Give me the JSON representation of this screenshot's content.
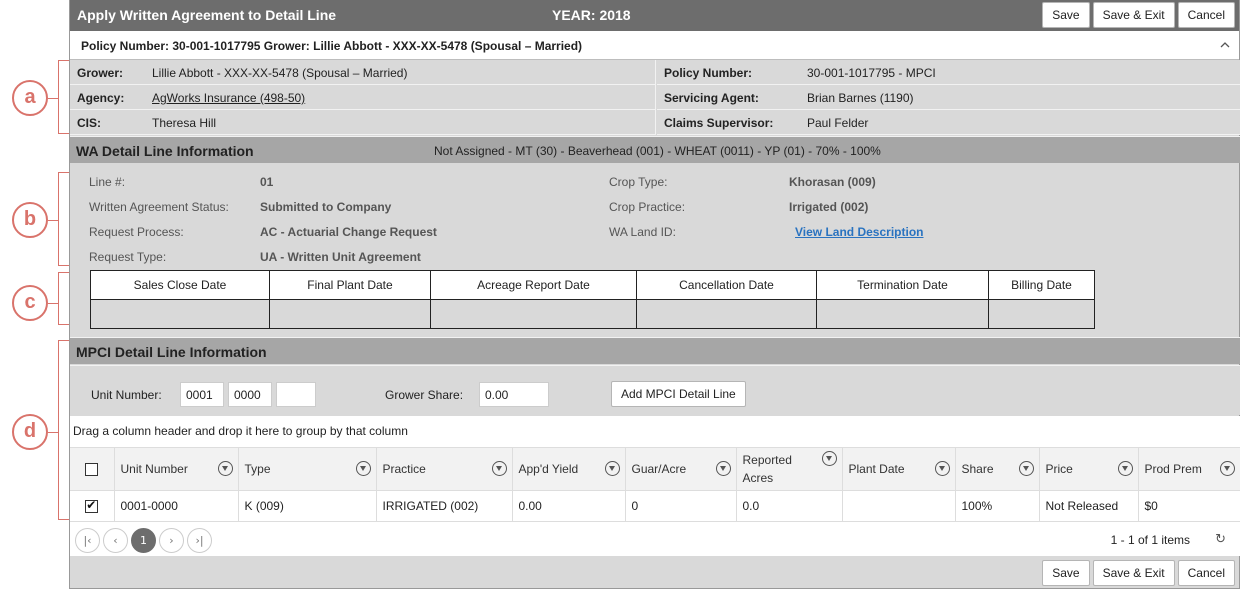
{
  "callouts": [
    "a",
    "b",
    "c",
    "d"
  ],
  "window": {
    "title": "Apply Written Agreement to Detail Line",
    "year": "YEAR: 2018"
  },
  "actions": {
    "save": "Save",
    "save_exit": "Save & Exit",
    "cancel": "Cancel"
  },
  "policy_bar": {
    "text": "Policy Number: 30-001-1017795 Grower: Lillie Abbott - XXX-XX-5478 (Spousal – Married)"
  },
  "info": {
    "grower_label": "Grower:",
    "grower": "Lillie Abbott - XXX-XX-5478 (Spousal – Married)",
    "agency_label": "Agency:",
    "agency": "AgWorks Insurance (498-50)",
    "cis_label": "CIS:",
    "cis": "Theresa Hill",
    "policy_label": "Policy Number:",
    "policy": "30-001-1017795 - MPCI",
    "agent_label": "Servicing Agent:",
    "agent": "Brian Barnes (1190)",
    "supervisor_label": "Claims Supervisor:",
    "supervisor": "Paul Felder"
  },
  "wa_section": {
    "title": "WA Detail Line Information",
    "summary": "Not Assigned - MT (30) - Beaverhead (001) - WHEAT (0011) - YP (01) - 70% - 100%"
  },
  "wa": {
    "line_label": "Line #:",
    "line": "01",
    "status_label": "Written Agreement Status:",
    "status": "Submitted to Company",
    "process_label": "Request Process:",
    "process": "AC - Actuarial Change Request",
    "type_label": "Request Type:",
    "type": "UA - Written Unit Agreement",
    "crop_type_label": "Crop Type:",
    "crop_type": "Khorasan (009)",
    "crop_practice_label": "Crop Practice:",
    "crop_practice": "Irrigated (002)",
    "land_label": "WA Land ID:",
    "land_link": "View Land Description"
  },
  "dates": [
    "Sales Close Date",
    "Final Plant Date",
    "Acreage Report Date",
    "Cancellation Date",
    "Termination Date",
    "Billing Date"
  ],
  "mpci_section": {
    "title": "MPCI Detail Line Information"
  },
  "mpci": {
    "unit_label": "Unit Number:",
    "unit1": "0001",
    "unit2": "0000",
    "unit3": "",
    "share_label": "Grower Share:",
    "share": "0.00",
    "add_button": "Add MPCI Detail Line"
  },
  "grid": {
    "group_hint": "Drag a column header and drop it here to group by that column",
    "columns": [
      "Unit Number",
      "Type",
      "Practice",
      "App'd Yield",
      "Guar/Acre",
      "Reported Acres",
      "Plant Date",
      "Share",
      "Price",
      "Prod Prem"
    ],
    "rows": [
      {
        "checked": true,
        "cells": [
          "0001-0000",
          "K (009)",
          "IRRIGATED (002)",
          "0.00",
          "0",
          "0.0",
          "",
          "100%",
          "Not Released",
          "$0"
        ]
      }
    ],
    "pager": {
      "first": "|‹",
      "prev": "‹",
      "current": "1",
      "next": "›",
      "last": "›|"
    },
    "items_info": "1 - 1 of 1 items",
    "refresh": "↻"
  }
}
